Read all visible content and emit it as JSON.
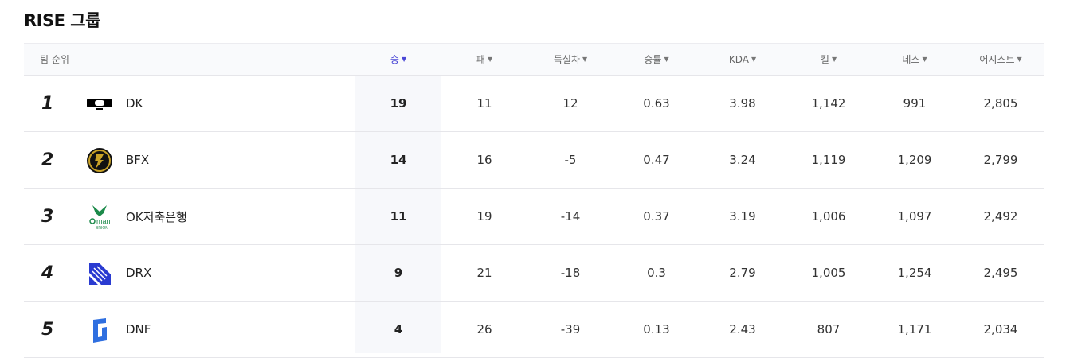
{
  "group_title": "RISE 그룹",
  "headers": {
    "rank": "팀 순위",
    "wins": "승",
    "losses": "패",
    "diff": "득실차",
    "rate": "승률",
    "kda": "KDA",
    "kills": "킬",
    "deaths": "데스",
    "assists": "어시스트"
  },
  "sort_caret": "▼",
  "rows": [
    {
      "rank": "1",
      "team": "DK",
      "logo": "dk-logo-icon",
      "wins": "19",
      "losses": "11",
      "diff": "12",
      "rate": "0.63",
      "kda": "3.98",
      "kills": "1,142",
      "deaths": "991",
      "assists": "2,805"
    },
    {
      "rank": "2",
      "team": "BFX",
      "logo": "bfx-logo-icon",
      "wins": "14",
      "losses": "16",
      "diff": "-5",
      "rate": "0.47",
      "kda": "3.24",
      "kills": "1,119",
      "deaths": "1,209",
      "assists": "2,799"
    },
    {
      "rank": "3",
      "team": "OK저축은행",
      "logo": "ok-brion-logo-icon",
      "logo_text": "man",
      "logo_subtext": "BRION",
      "wins": "11",
      "losses": "19",
      "diff": "-14",
      "rate": "0.37",
      "kda": "3.19",
      "kills": "1,006",
      "deaths": "1,097",
      "assists": "2,492"
    },
    {
      "rank": "4",
      "team": "DRX",
      "logo": "drx-logo-icon",
      "wins": "9",
      "losses": "21",
      "diff": "-18",
      "rate": "0.3",
      "kda": "2.79",
      "kills": "1,005",
      "deaths": "1,254",
      "assists": "2,495"
    },
    {
      "rank": "5",
      "team": "DNF",
      "logo": "dnf-logo-icon",
      "wins": "4",
      "losses": "26",
      "diff": "-39",
      "rate": "0.13",
      "kda": "2.43",
      "kills": "807",
      "deaths": "1,171",
      "assists": "2,034"
    }
  ],
  "colors": {
    "sorted_header": "#4a47d6",
    "dk": "#000000",
    "bfx": "#c9a227",
    "ok_brion": "#1c8a4a",
    "drx": "#2a3bd1",
    "dnf": "#2f6fe0"
  }
}
